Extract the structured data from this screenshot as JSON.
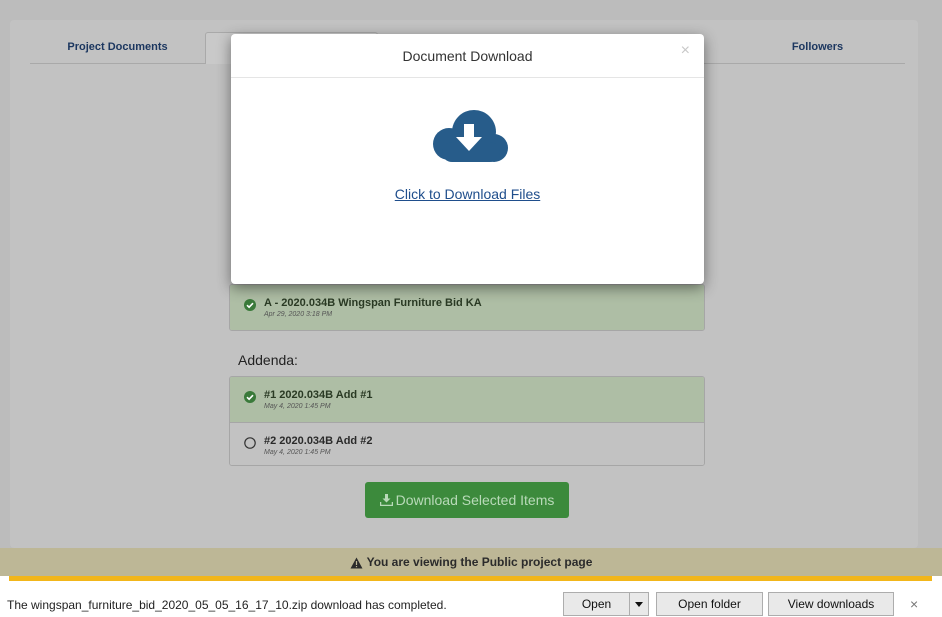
{
  "tabs": {
    "project_documents": "Project Documents",
    "active_tab": "",
    "followers": "Followers"
  },
  "modal": {
    "title": "Document Download",
    "close": "×",
    "icon": "cloud-download-icon",
    "download_link": "Click to Download Files"
  },
  "documents": {
    "items": [
      {
        "name": "A - 2020.034B Wingspan Furniture Bid KA",
        "date": "Apr 29, 2020 3:18 PM",
        "selected": true
      }
    ]
  },
  "addenda": {
    "label": "Addenda:",
    "items": [
      {
        "name": "#1 2020.034B Add #1",
        "date": "May 4, 2020 1:45 PM",
        "selected": true
      },
      {
        "name": "#2 2020.034B Add #2",
        "date": "May 4, 2020 1:45 PM",
        "selected": false
      }
    ]
  },
  "download_button": {
    "label": "Download Selected Items",
    "icon": "download-icon"
  },
  "notice": {
    "text": "You are viewing the Public project page",
    "icon": "warning-icon"
  },
  "download_bar": {
    "message": "The wingspan_furniture_bid_2020_05_05_16_17_10.zip download has completed.",
    "open": "Open",
    "open_folder": "Open folder",
    "view_downloads": "View downloads",
    "close": "×"
  },
  "colors": {
    "accent_link": "#1f4e8c",
    "selected_row": "#aebea5",
    "button_green": "#3c8a3c",
    "notice_bar": "#bdb796",
    "progress_stripe": "#f2b61a"
  }
}
